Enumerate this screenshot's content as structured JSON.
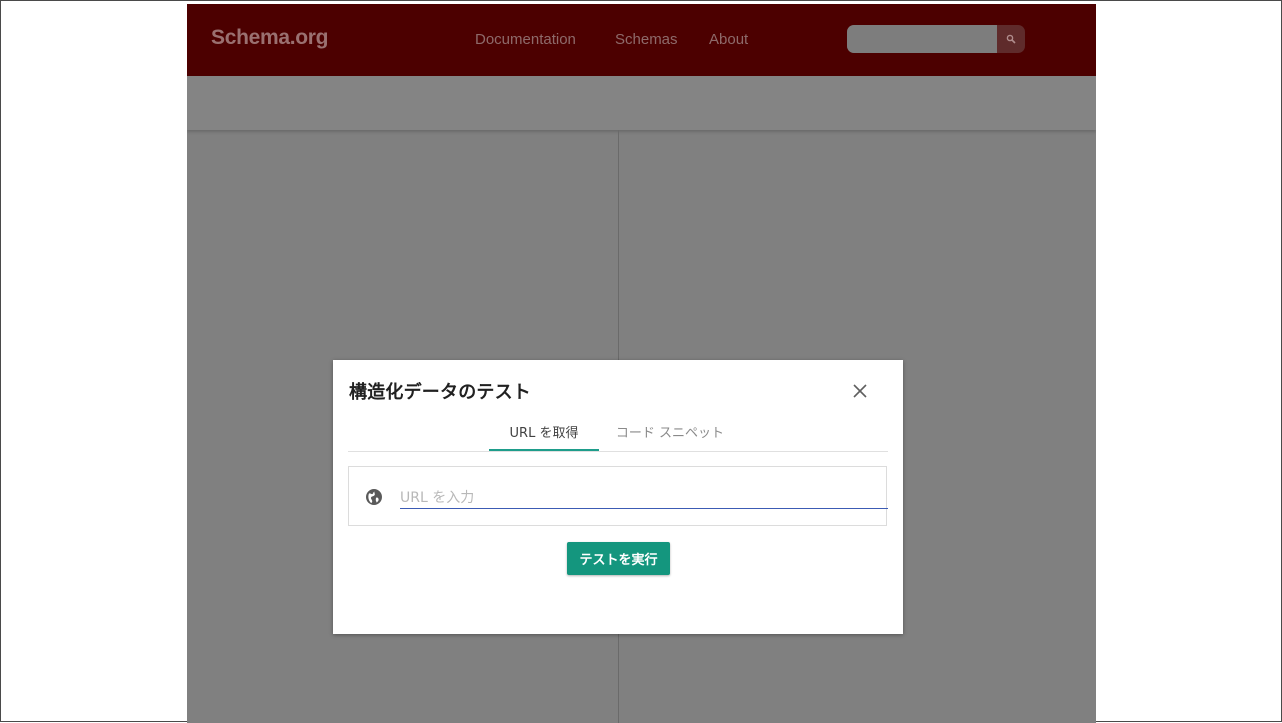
{
  "header": {
    "brand": "Schema.org",
    "nav": [
      {
        "label": "Documentation"
      },
      {
        "label": "Schemas"
      },
      {
        "label": "About"
      }
    ],
    "search": {
      "value": "",
      "icon": "search-icon"
    }
  },
  "modal": {
    "title": "構造化データのテスト",
    "close_icon": "close-icon",
    "tabs": [
      {
        "label": "URL を取得",
        "active": true
      },
      {
        "label": "コード スニペット",
        "active": false
      }
    ],
    "url_input": {
      "placeholder": "URL を入力",
      "value": "",
      "icon": "globe-icon"
    },
    "run_button": "テストを実行"
  },
  "colors": {
    "navbar": "#4c0000",
    "accent": "#14967e",
    "overlay": "#808080"
  }
}
